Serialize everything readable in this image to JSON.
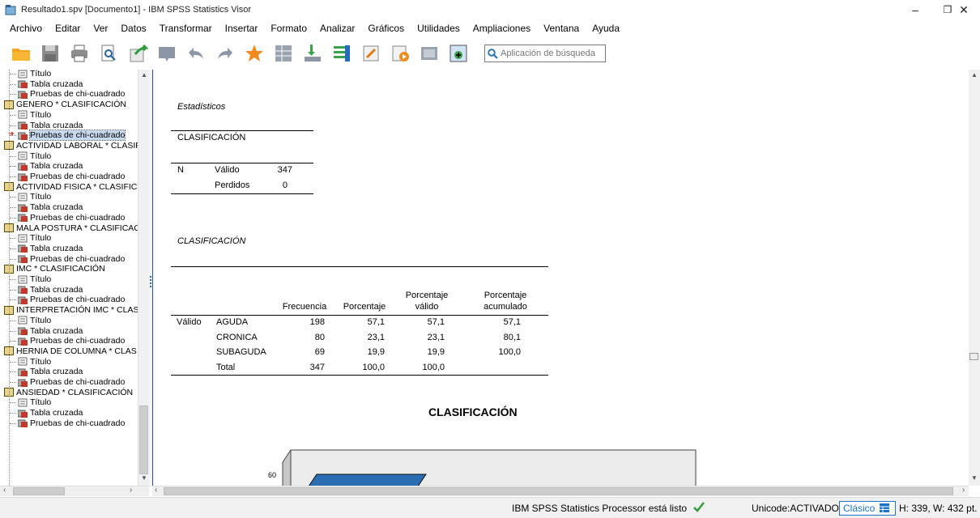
{
  "window": {
    "title": "Resultado1.spv [Documento1] - IBM SPSS Statistics Visor",
    "controls": [
      "–",
      "❐",
      "✕"
    ]
  },
  "menu": [
    "Archivo",
    "Editar",
    "Ver",
    "Datos",
    "Transformar",
    "Insertar",
    "Formato",
    "Analizar",
    "Gráficos",
    "Utilidades",
    "Ampliaciones",
    "Ventana",
    "Ayuda"
  ],
  "search": {
    "placeholder": "Aplicación de búsqueda"
  },
  "nav": {
    "items": [
      {
        "label": "Título",
        "level": 1
      },
      {
        "label": "Tabla cruzada",
        "level": 1
      },
      {
        "label": "Pruebas de chi-cuadrado",
        "level": 1
      },
      {
        "label": "GENERO * CLASIFICACIÓN",
        "level": 0
      },
      {
        "label": "Título",
        "level": 1
      },
      {
        "label": "Tabla cruzada",
        "level": 1
      },
      {
        "label": "Pruebas de chi-cuadrado",
        "level": 1,
        "selected": true
      },
      {
        "label": "ACTIVIDAD LABORAL * CLASIF",
        "level": 0
      },
      {
        "label": "Título",
        "level": 1
      },
      {
        "label": "Tabla cruzada",
        "level": 1
      },
      {
        "label": "Pruebas de chi-cuadrado",
        "level": 1
      },
      {
        "label": "ACTIVIDAD FISICA  * CLASIFIC",
        "level": 0
      },
      {
        "label": "Título",
        "level": 1
      },
      {
        "label": "Tabla cruzada",
        "level": 1
      },
      {
        "label": "Pruebas de chi-cuadrado",
        "level": 1
      },
      {
        "label": "MALA POSTURA * CLASIFICAC",
        "level": 0
      },
      {
        "label": "Título",
        "level": 1
      },
      {
        "label": "Tabla cruzada",
        "level": 1
      },
      {
        "label": "Pruebas de chi-cuadrado",
        "level": 1
      },
      {
        "label": "IMC * CLASIFICACIÓN",
        "level": 0
      },
      {
        "label": "Título",
        "level": 1
      },
      {
        "label": "Tabla cruzada",
        "level": 1
      },
      {
        "label": "Pruebas de chi-cuadrado",
        "level": 1
      },
      {
        "label": "INTERPRETACIÓN IMC * CLAS",
        "level": 0
      },
      {
        "label": "Título",
        "level": 1
      },
      {
        "label": "Tabla cruzada",
        "level": 1
      },
      {
        "label": "Pruebas de chi-cuadrado",
        "level": 1
      },
      {
        "label": "HERNIA DE COLUMNA * CLAS",
        "level": 0
      },
      {
        "label": "Título",
        "level": 1
      },
      {
        "label": "Tabla cruzada",
        "level": 1
      },
      {
        "label": "Pruebas de chi-cuadrado",
        "level": 1
      },
      {
        "label": "ANSIEDAD * CLASIFICACIÓN",
        "level": 0
      },
      {
        "label": "Título",
        "level": 1
      },
      {
        "label": "Tabla cruzada",
        "level": 1
      },
      {
        "label": "Pruebas de chi-cuadrado",
        "level": 1
      }
    ]
  },
  "stats_table": {
    "title": "Estadísticos",
    "variable": "CLASIFICACIÓN",
    "n_label": "N",
    "rows": [
      {
        "label": "Válido",
        "value": "347"
      },
      {
        "label": "Perdidos",
        "value": "0"
      }
    ]
  },
  "freq_table": {
    "title": "CLASIFICACIÓN",
    "headers": [
      "Frecuencia",
      "Porcentaje",
      "Porcentaje válido",
      "Porcentaje acumulado"
    ],
    "header_lines": [
      [
        "Frecuencia"
      ],
      [
        "Porcentaje"
      ],
      [
        "Porcentaje",
        "válido"
      ],
      [
        "Porcentaje",
        "acumulado"
      ]
    ],
    "group_label": "Válido",
    "rows": [
      {
        "label": "AGUDA",
        "freq": "198",
        "pct": "57,1",
        "valid": "57,1",
        "cum": "57,1"
      },
      {
        "label": "CRONICA",
        "freq": "80",
        "pct": "23,1",
        "valid": "23,1",
        "cum": "80,1"
      },
      {
        "label": "SUBAGUDA",
        "freq": "69",
        "pct": "19,9",
        "valid": "19,9",
        "cum": "100,0"
      },
      {
        "label": "Total",
        "freq": "347",
        "pct": "100,0",
        "valid": "100,0",
        "cum": ""
      }
    ]
  },
  "chart": {
    "title": "CLASIFICACIÓN",
    "visible_tick": "60",
    "bar_color": "#1f5f99"
  },
  "status": {
    "processor": "IBM SPSS Statistics Processor está listo",
    "unicode": "Unicode:ACTIVADO",
    "mode": "Clásico",
    "size": "H: 339, W: 432 pt."
  }
}
